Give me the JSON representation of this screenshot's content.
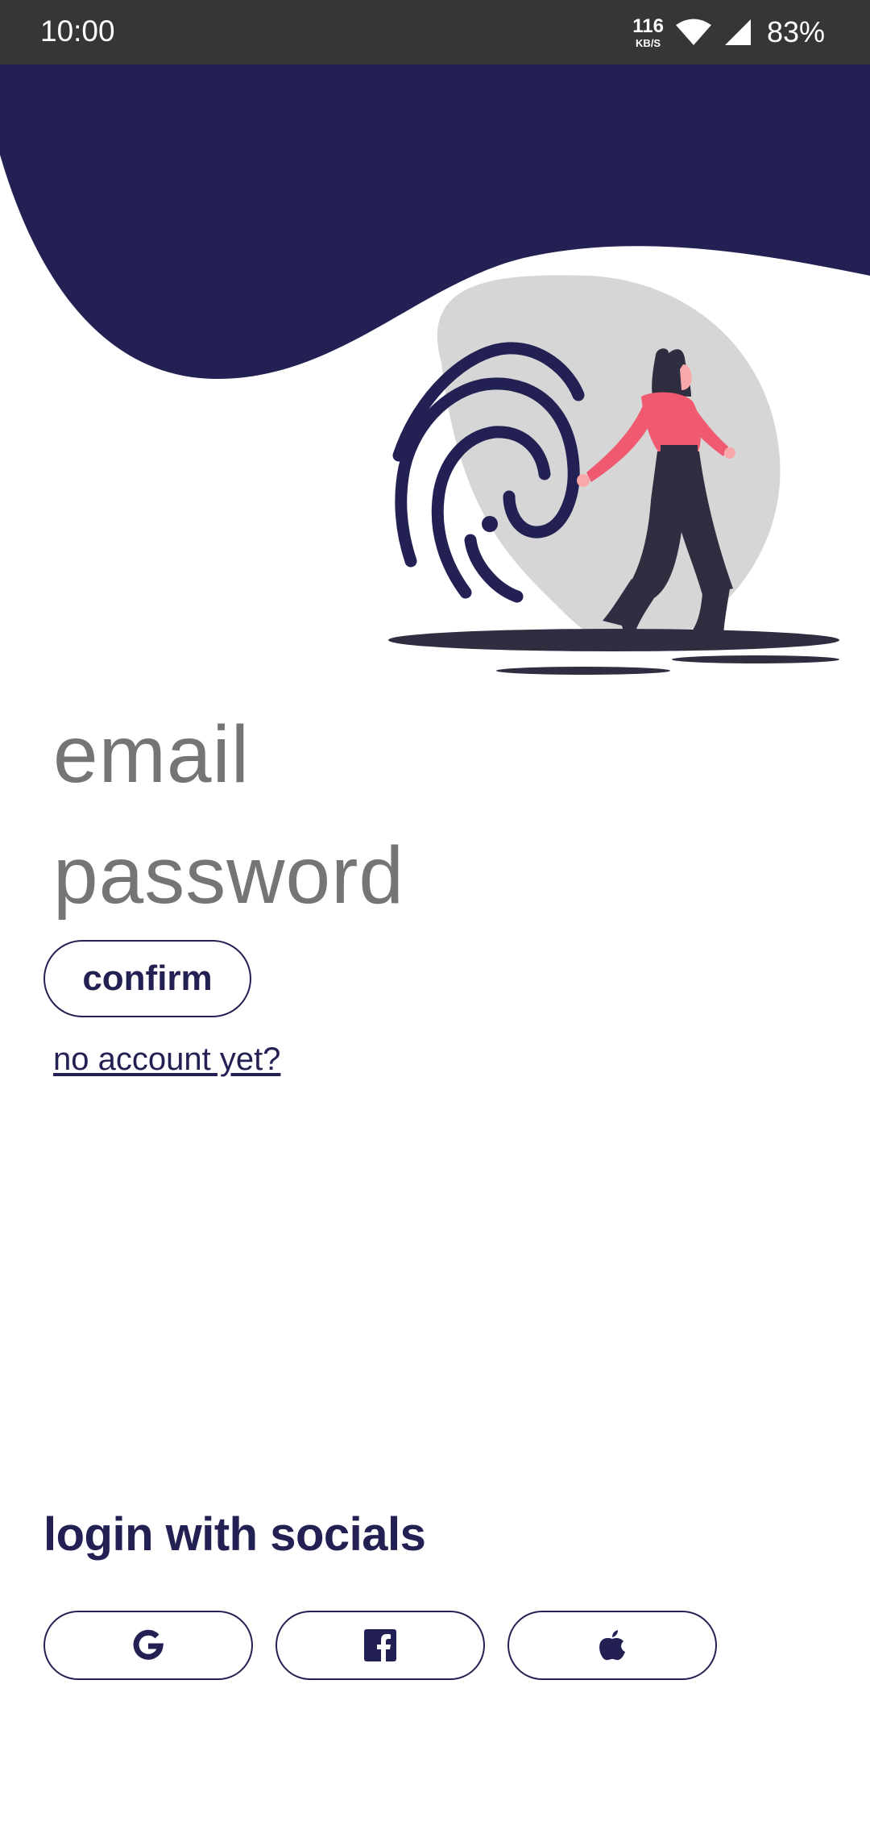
{
  "status_bar": {
    "time": "10:00",
    "net_speed_value": "116",
    "net_speed_unit": "KB/S",
    "battery": "83%"
  },
  "colors": {
    "brand": "#232153",
    "illustration_circle": "#D6D6D6",
    "figure_top": "#F05A70",
    "figure_dark": "#2F2E41",
    "field_text": "#757575"
  },
  "login": {
    "email_placeholder": "email",
    "password_placeholder": "password",
    "confirm_label": "confirm",
    "no_account_link": "no account yet?"
  },
  "socials": {
    "title": "login with socials",
    "buttons": [
      {
        "icon": "google-icon"
      },
      {
        "icon": "facebook-icon"
      },
      {
        "icon": "apple-icon"
      }
    ]
  }
}
